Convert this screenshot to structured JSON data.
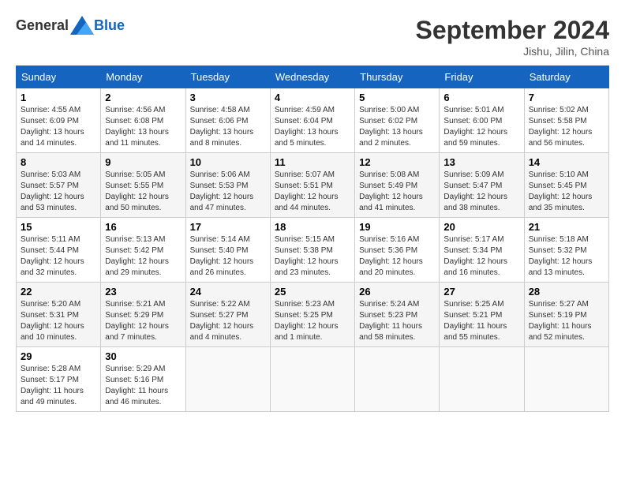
{
  "header": {
    "logo_general": "General",
    "logo_blue": "Blue",
    "title": "September 2024",
    "location": "Jishu, Jilin, China"
  },
  "calendar": {
    "days_of_week": [
      "Sunday",
      "Monday",
      "Tuesday",
      "Wednesday",
      "Thursday",
      "Friday",
      "Saturday"
    ],
    "weeks": [
      [
        {
          "day": "1",
          "sunrise": "4:55 AM",
          "sunset": "6:09 PM",
          "daylight": "13 hours and 14 minutes."
        },
        {
          "day": "2",
          "sunrise": "4:56 AM",
          "sunset": "6:08 PM",
          "daylight": "13 hours and 11 minutes."
        },
        {
          "day": "3",
          "sunrise": "4:58 AM",
          "sunset": "6:06 PM",
          "daylight": "13 hours and 8 minutes."
        },
        {
          "day": "4",
          "sunrise": "4:59 AM",
          "sunset": "6:04 PM",
          "daylight": "13 hours and 5 minutes."
        },
        {
          "day": "5",
          "sunrise": "5:00 AM",
          "sunset": "6:02 PM",
          "daylight": "13 hours and 2 minutes."
        },
        {
          "day": "6",
          "sunrise": "5:01 AM",
          "sunset": "6:00 PM",
          "daylight": "12 hours and 59 minutes."
        },
        {
          "day": "7",
          "sunrise": "5:02 AM",
          "sunset": "5:58 PM",
          "daylight": "12 hours and 56 minutes."
        }
      ],
      [
        {
          "day": "8",
          "sunrise": "5:03 AM",
          "sunset": "5:57 PM",
          "daylight": "12 hours and 53 minutes."
        },
        {
          "day": "9",
          "sunrise": "5:05 AM",
          "sunset": "5:55 PM",
          "daylight": "12 hours and 50 minutes."
        },
        {
          "day": "10",
          "sunrise": "5:06 AM",
          "sunset": "5:53 PM",
          "daylight": "12 hours and 47 minutes."
        },
        {
          "day": "11",
          "sunrise": "5:07 AM",
          "sunset": "5:51 PM",
          "daylight": "12 hours and 44 minutes."
        },
        {
          "day": "12",
          "sunrise": "5:08 AM",
          "sunset": "5:49 PM",
          "daylight": "12 hours and 41 minutes."
        },
        {
          "day": "13",
          "sunrise": "5:09 AM",
          "sunset": "5:47 PM",
          "daylight": "12 hours and 38 minutes."
        },
        {
          "day": "14",
          "sunrise": "5:10 AM",
          "sunset": "5:45 PM",
          "daylight": "12 hours and 35 minutes."
        }
      ],
      [
        {
          "day": "15",
          "sunrise": "5:11 AM",
          "sunset": "5:44 PM",
          "daylight": "12 hours and 32 minutes."
        },
        {
          "day": "16",
          "sunrise": "5:13 AM",
          "sunset": "5:42 PM",
          "daylight": "12 hours and 29 minutes."
        },
        {
          "day": "17",
          "sunrise": "5:14 AM",
          "sunset": "5:40 PM",
          "daylight": "12 hours and 26 minutes."
        },
        {
          "day": "18",
          "sunrise": "5:15 AM",
          "sunset": "5:38 PM",
          "daylight": "12 hours and 23 minutes."
        },
        {
          "day": "19",
          "sunrise": "5:16 AM",
          "sunset": "5:36 PM",
          "daylight": "12 hours and 20 minutes."
        },
        {
          "day": "20",
          "sunrise": "5:17 AM",
          "sunset": "5:34 PM",
          "daylight": "12 hours and 16 minutes."
        },
        {
          "day": "21",
          "sunrise": "5:18 AM",
          "sunset": "5:32 PM",
          "daylight": "12 hours and 13 minutes."
        }
      ],
      [
        {
          "day": "22",
          "sunrise": "5:20 AM",
          "sunset": "5:31 PM",
          "daylight": "12 hours and 10 minutes."
        },
        {
          "day": "23",
          "sunrise": "5:21 AM",
          "sunset": "5:29 PM",
          "daylight": "12 hours and 7 minutes."
        },
        {
          "day": "24",
          "sunrise": "5:22 AM",
          "sunset": "5:27 PM",
          "daylight": "12 hours and 4 minutes."
        },
        {
          "day": "25",
          "sunrise": "5:23 AM",
          "sunset": "5:25 PM",
          "daylight": "12 hours and 1 minute."
        },
        {
          "day": "26",
          "sunrise": "5:24 AM",
          "sunset": "5:23 PM",
          "daylight": "11 hours and 58 minutes."
        },
        {
          "day": "27",
          "sunrise": "5:25 AM",
          "sunset": "5:21 PM",
          "daylight": "11 hours and 55 minutes."
        },
        {
          "day": "28",
          "sunrise": "5:27 AM",
          "sunset": "5:19 PM",
          "daylight": "11 hours and 52 minutes."
        }
      ],
      [
        {
          "day": "29",
          "sunrise": "5:28 AM",
          "sunset": "5:17 PM",
          "daylight": "11 hours and 49 minutes."
        },
        {
          "day": "30",
          "sunrise": "5:29 AM",
          "sunset": "5:16 PM",
          "daylight": "11 hours and 46 minutes."
        },
        null,
        null,
        null,
        null,
        null
      ]
    ]
  }
}
